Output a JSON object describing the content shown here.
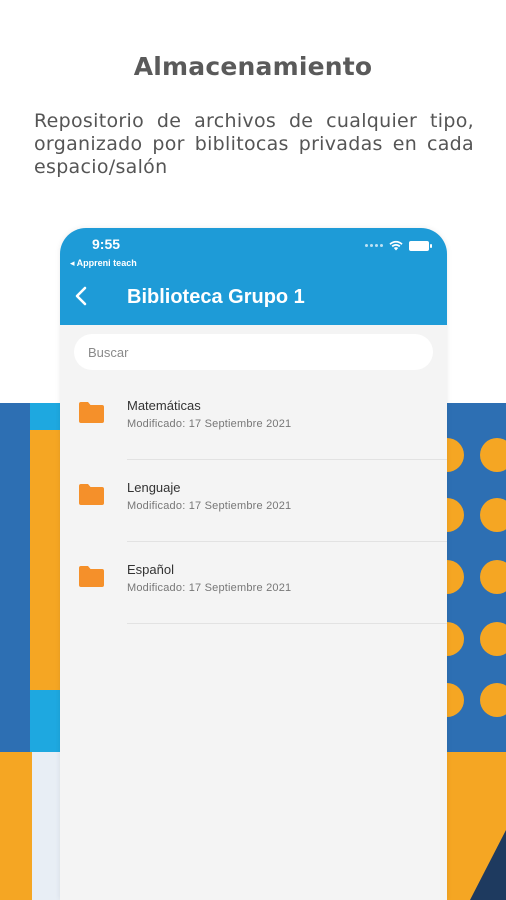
{
  "promo": {
    "title": "Almacenamiento",
    "description": "Repositorio de archivos de cualquier tipo, organizado por biblitocas privadas en cada espacio/salón"
  },
  "status_bar": {
    "time": "9:55",
    "back_app": "◂ Appreni teach"
  },
  "header": {
    "title": "Biblioteca Grupo 1",
    "back_icon": "chevron-left-icon"
  },
  "search": {
    "placeholder": "Buscar"
  },
  "folders": [
    {
      "name": "Matemáticas",
      "modified": "Modificado: 17 Septiembre 2021",
      "icon": "folder-icon"
    },
    {
      "name": "Lenguaje",
      "modified": "Modificado: 17 Septiembre 2021",
      "icon": "folder-icon"
    },
    {
      "name": "Español",
      "modified": "Modificado: 17 Septiembre 2021",
      "icon": "folder-icon"
    }
  ],
  "colors": {
    "accent": "#1e9bd7",
    "folder": "#f5902a",
    "deco_orange": "#f5a623",
    "deco_blue": "#2d6fb3",
    "deco_cyan": "#1ea8e0"
  }
}
